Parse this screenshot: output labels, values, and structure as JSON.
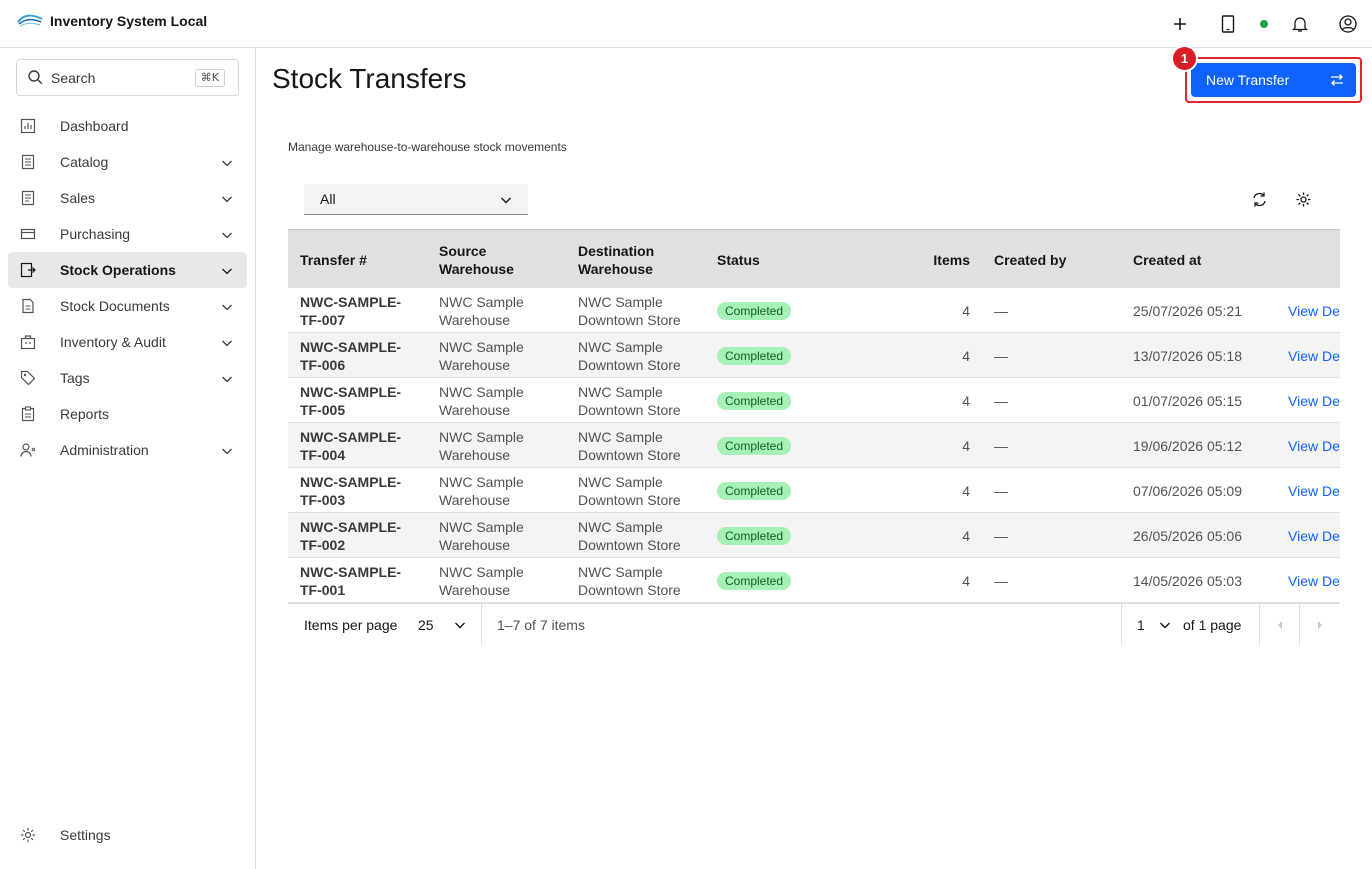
{
  "app": {
    "title": "Inventory System Local"
  },
  "sidebar": {
    "search_label": "Search",
    "search_shortcut": "⌘K",
    "items": [
      {
        "label": "Dashboard",
        "icon": "dashboard-icon",
        "expandable": false
      },
      {
        "label": "Catalog",
        "icon": "catalog-icon",
        "expandable": true
      },
      {
        "label": "Sales",
        "icon": "sales-icon",
        "expandable": true
      },
      {
        "label": "Purchasing",
        "icon": "purchasing-icon",
        "expandable": true
      },
      {
        "label": "Stock Operations",
        "icon": "stock-operations-icon",
        "expandable": true,
        "active": true
      },
      {
        "label": "Stock Documents",
        "icon": "document-icon",
        "expandable": true
      },
      {
        "label": "Inventory & Audit",
        "icon": "inventory-icon",
        "expandable": true
      },
      {
        "label": "Tags",
        "icon": "tag-icon",
        "expandable": true
      },
      {
        "label": "Reports",
        "icon": "reports-icon",
        "expandable": false
      },
      {
        "label": "Administration",
        "icon": "admin-icon",
        "expandable": true
      }
    ],
    "settings_label": "Settings"
  },
  "page": {
    "title": "Stock Transfers",
    "subtitle": "Manage warehouse-to-warehouse stock movements",
    "new_button": "New Transfer",
    "annotation_badge": "1",
    "filter_value": "All"
  },
  "table": {
    "headers": [
      "Transfer #",
      "Source Warehouse",
      "Destination Warehouse",
      "Status",
      "Items",
      "Created by",
      "Created at",
      ""
    ],
    "rows": [
      {
        "id": "NWC-SAMPLE-TF-007",
        "source": "NWC Sample Warehouse",
        "destination": "NWC Sample Downtown Store",
        "status": "Completed",
        "items": "4",
        "created_by": "—",
        "created_at": "25/07/2026 05:21",
        "action": "View De"
      },
      {
        "id": "NWC-SAMPLE-TF-006",
        "source": "NWC Sample Warehouse",
        "destination": "NWC Sample Downtown Store",
        "status": "Completed",
        "items": "4",
        "created_by": "—",
        "created_at": "13/07/2026 05:18",
        "action": "View De"
      },
      {
        "id": "NWC-SAMPLE-TF-005",
        "source": "NWC Sample Warehouse",
        "destination": "NWC Sample Downtown Store",
        "status": "Completed",
        "items": "4",
        "created_by": "—",
        "created_at": "01/07/2026 05:15",
        "action": "View De"
      },
      {
        "id": "NWC-SAMPLE-TF-004",
        "source": "NWC Sample Warehouse",
        "destination": "NWC Sample Downtown Store",
        "status": "Completed",
        "items": "4",
        "created_by": "—",
        "created_at": "19/06/2026 05:12",
        "action": "View De"
      },
      {
        "id": "NWC-SAMPLE-TF-003",
        "source": "NWC Sample Warehouse",
        "destination": "NWC Sample Downtown Store",
        "status": "Completed",
        "items": "4",
        "created_by": "—",
        "created_at": "07/06/2026 05:09",
        "action": "View De"
      },
      {
        "id": "NWC-SAMPLE-TF-002",
        "source": "NWC Sample Warehouse",
        "destination": "NWC Sample Downtown Store",
        "status": "Completed",
        "items": "4",
        "created_by": "—",
        "created_at": "26/05/2026 05:06",
        "action": "View De"
      },
      {
        "id": "NWC-SAMPLE-TF-001",
        "source": "NWC Sample Warehouse",
        "destination": "NWC Sample Downtown Store",
        "status": "Completed",
        "items": "4",
        "created_by": "—",
        "created_at": "14/05/2026 05:03",
        "action": "View De"
      }
    ]
  },
  "pagination": {
    "items_per_page_label": "Items per page",
    "items_per_page_value": "25",
    "range_text": "1–7 of 7 items",
    "current_page": "1",
    "of_pages_text": "of 1 page"
  },
  "colors": {
    "primary": "#0f62fe",
    "status_completed_bg": "#a7f0ba",
    "status_completed_text": "#0e6027",
    "annotation_red": "#da1e28",
    "online_dot": "#24a148"
  }
}
